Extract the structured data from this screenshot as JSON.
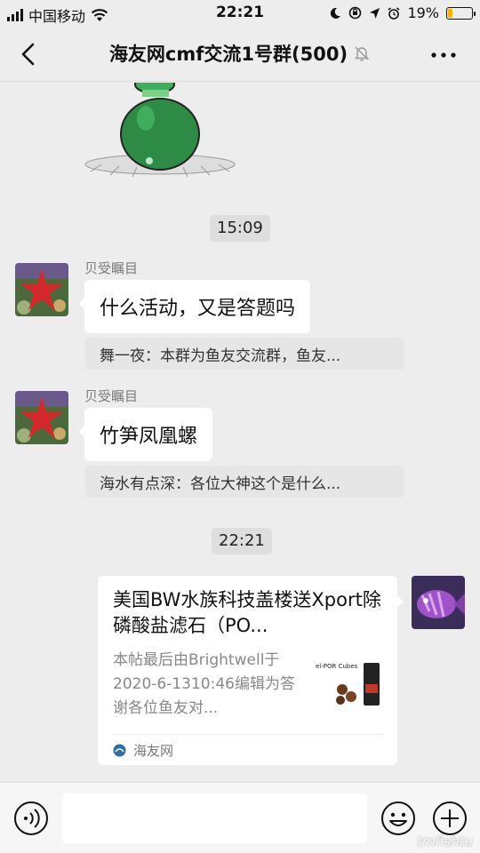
{
  "status_bar": {
    "carrier": "中国移动",
    "time": "22:21",
    "battery": "19%",
    "battery_level": 0.19
  },
  "nav": {
    "title": "海友网cmf交流1号群(500)",
    "icons": [
      "back-icon",
      "mute-bell-icon",
      "more-icon"
    ]
  },
  "messages": [
    {
      "type": "time",
      "text": "15:09"
    },
    {
      "type": "text",
      "sender": "贝受瞩目",
      "text": "什么活动，又是答题吗",
      "quote": "舞一夜：本群为鱼友交流群，鱼友..."
    },
    {
      "type": "text",
      "sender": "贝受瞩目",
      "text": "竹笋凤凰螺",
      "quote": "海水有点深：各位大神这个是什么..."
    },
    {
      "type": "time",
      "text": "22:21"
    },
    {
      "type": "link",
      "title": "美国BW水族科技盖楼送Xport除磷酸盐滤石（PO...",
      "desc": "本帖最后由Brightwell于2020-6-1310:46编辑为答谢各位鱼友对...",
      "thumb_text": "el-POR Cubes",
      "source": "海友网"
    }
  ],
  "input_bar": {
    "icons": [
      "voice-icon",
      "emoji-icon",
      "plus-icon"
    ],
    "watermark": "tmfishtu"
  }
}
